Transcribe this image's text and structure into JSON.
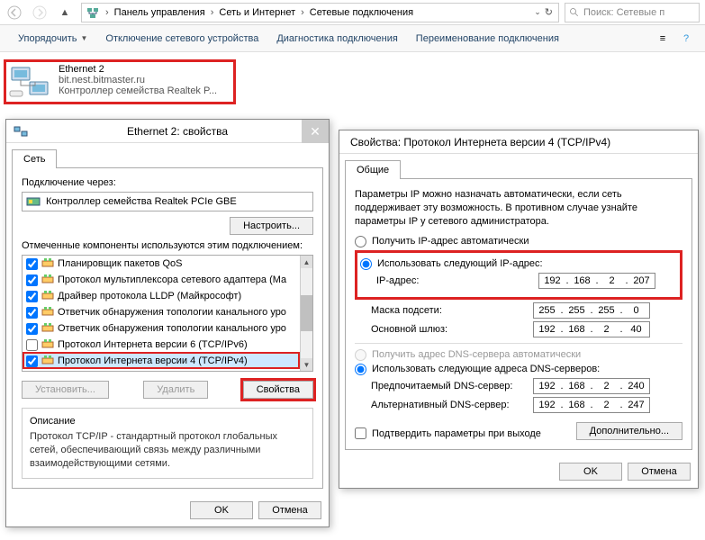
{
  "breadcrumbs": {
    "a": "Панель управления",
    "b": "Сеть и Интернет",
    "c": "Сетевые подключения"
  },
  "search": {
    "placeholder": "Поиск: Сетевые п"
  },
  "cmdbar": {
    "org": "Упорядочить",
    "dis": "Отключение сетевого устройства",
    "diag": "Диагностика подключения",
    "ren": "Переименование подключения"
  },
  "conn": {
    "name": "Ethernet 2",
    "domain": "bit.nest.bitmaster.ru",
    "dev": "Контроллер семейства Realtek P..."
  },
  "props": {
    "title": "Ethernet 2: свойства",
    "tab": "Сеть",
    "connect_via": "Подключение через:",
    "adapter": "Контроллер семейства Realtek PCIe GBE",
    "configure": "Настроить...",
    "comps_lbl": "Отмеченные компоненты используются этим подключением:",
    "comps": [
      {
        "c": true,
        "t": "Планировщик пакетов QoS"
      },
      {
        "c": true,
        "t": "Протокол мультиплексора сетевого адаптера (Ма"
      },
      {
        "c": true,
        "t": "Драйвер протокола LLDP (Майкрософт)"
      },
      {
        "c": true,
        "t": "Ответчик обнаружения топологии канального уро"
      },
      {
        "c": true,
        "t": "Ответчик обнаружения топологии канального уро"
      },
      {
        "c": false,
        "t": "Протокол Интернета версии 6 (TCP/IPv6)"
      },
      {
        "c": true,
        "t": "Протокол Интернета версии 4 (TCP/IPv4)",
        "sel": true
      }
    ],
    "install": "Установить...",
    "remove": "Удалить",
    "props_btn": "Свойства",
    "desc_title": "Описание",
    "desc": "Протокол TCP/IP - стандартный протокол глобальных сетей, обеспечивающий связь между различными взаимодействующими сетями.",
    "ok": "OK",
    "cancel": "Отмена"
  },
  "ipv4": {
    "title": "Свойства: Протокол Интернета версии 4 (TCP/IPv4)",
    "tab": "Общие",
    "info": "Параметры IP можно назначать автоматически, если сеть поддерживает эту возможность. В противном случае узнайте параметры IP у сетевого администратора.",
    "r_auto": "Получить IP-адрес автоматически",
    "r_man": "Использовать следующий IP-адрес:",
    "ip_lbl": "IP-адрес:",
    "ip": [
      "192",
      "168",
      "2",
      "207"
    ],
    "mask_lbl": "Маска подсети:",
    "mask": [
      "255",
      "255",
      "255",
      "0"
    ],
    "gw_lbl": "Основной шлюз:",
    "gw": [
      "192",
      "168",
      "2",
      "40"
    ],
    "dns_auto": "Получить адрес DNS-сервера автоматически",
    "dns_man": "Использовать следующие адреса DNS-серверов:",
    "dns1_lbl": "Предпочитаемый DNS-сервер:",
    "dns1": [
      "192",
      "168",
      "2",
      "240"
    ],
    "dns2_lbl": "Альтернативный DNS-сервер:",
    "dns2": [
      "192",
      "168",
      "2",
      "247"
    ],
    "validate": "Подтвердить параметры при выходе",
    "adv": "Дополнительно...",
    "ok": "OK",
    "cancel": "Отмена"
  }
}
